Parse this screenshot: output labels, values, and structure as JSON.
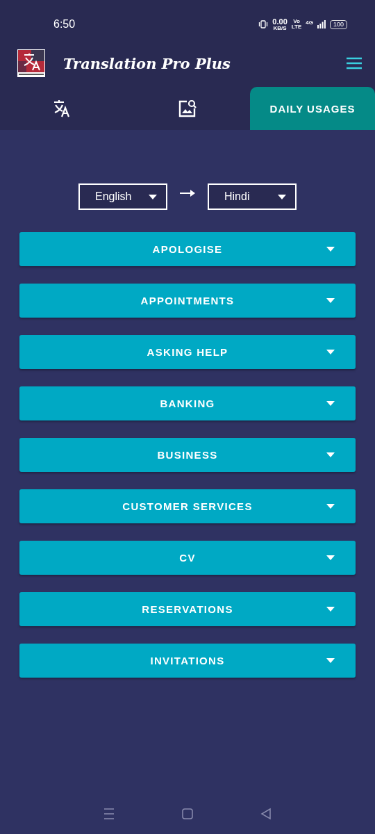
{
  "status_bar": {
    "time": "6:50",
    "speed": "0.00",
    "speed_unit": "KB/S",
    "volte_top": "Vo",
    "volte_bottom": "LTE",
    "network": "4G",
    "battery": "100"
  },
  "app_bar": {
    "title": "Translation Pro Plus"
  },
  "tabs": [
    {
      "kind": "translate",
      "selected": false
    },
    {
      "kind": "image-search",
      "selected": false
    },
    {
      "kind": "text",
      "label": "DAILY USAGES",
      "selected": true
    }
  ],
  "languages": {
    "from": "English",
    "to": "Hindi"
  },
  "categories": [
    "APOLOGISE",
    "APPOINTMENTS",
    "ASKING HELP",
    "BANKING",
    "BUSINESS",
    "CUSTOMER SERVICES",
    "CV",
    "RESERVATIONS",
    "INVITATIONS"
  ]
}
